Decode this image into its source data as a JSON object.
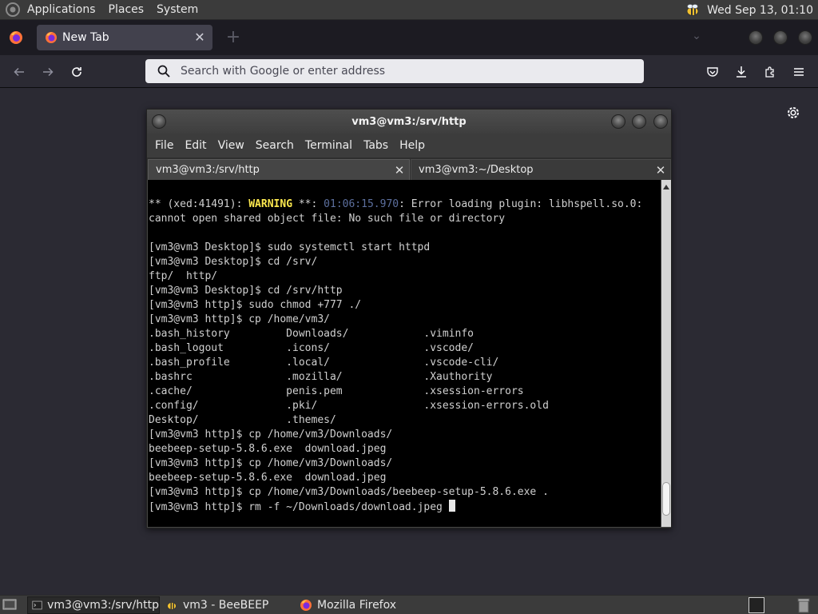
{
  "top_panel": {
    "menus": [
      "Applications",
      "Places",
      "System"
    ],
    "clock": "Wed Sep 13, 01:10",
    "tray_icon": "beebeep-bee-icon"
  },
  "browser": {
    "tab": {
      "label": "New Tab",
      "icon": "firefox-icon"
    },
    "urlbar": {
      "placeholder": "Search with Google or enter address",
      "value": ""
    },
    "colors": {
      "tab_bg": "#42414d",
      "toolbar_bg": "#2b2a33",
      "urlbar_bg": "#eaeaee"
    }
  },
  "terminal": {
    "title": "vm3@vm3:/srv/http",
    "menus": [
      "File",
      "Edit",
      "View",
      "Search",
      "Terminal",
      "Tabs",
      "Help"
    ],
    "tabs": [
      {
        "label": "vm3@vm3:/srv/http",
        "active": true
      },
      {
        "label": "vm3@vm3:~/Desktop",
        "active": false
      }
    ],
    "warning": {
      "prefix": "** (xed:41491): ",
      "label": "WARNING",
      "mid": " **: ",
      "time": "01:06:15.970",
      "message": ": Error loading plugin: libhspell.so.0:",
      "message2": "cannot open shared object file: No such file or directory"
    },
    "lines": [
      "[vm3@vm3 Desktop]$ sudo systemctl start httpd",
      "[vm3@vm3 Desktop]$ cd /srv/",
      "ftp/  http/",
      "[vm3@vm3 Desktop]$ cd /srv/http",
      "[vm3@vm3 http]$ sudo chmod +777 ./",
      "[vm3@vm3 http]$ cp /home/vm3/",
      ".bash_history         Downloads/            .viminfo",
      ".bash_logout          .icons/               .vscode/",
      ".bash_profile         .local/               .vscode-cli/",
      ".bashrc               .mozilla/             .Xauthority",
      ".cache/               penis.pem             .xsession-errors",
      ".config/              .pki/                 .xsession-errors.old",
      "Desktop/              .themes/",
      "[vm3@vm3 http]$ cp /home/vm3/Downloads/",
      "beebeep-setup-5.8.6.exe  download.jpeg",
      "[vm3@vm3 http]$ cp /home/vm3/Downloads/",
      "beebeep-setup-5.8.6.exe  download.jpeg",
      "[vm3@vm3 http]$ cp /home/vm3/Downloads/beebeep-setup-5.8.6.exe .",
      "[vm3@vm3 http]$ rm -f ~/Downloads/download.jpeg "
    ],
    "colors": {
      "bg": "#000000",
      "fg": "#d0d0d0",
      "warning": "#fce94f",
      "timestamp": "#5c6f9e"
    }
  },
  "taskbar": {
    "tasks": [
      {
        "label": "vm3@vm3:/srv/http",
        "icon": "terminal-icon",
        "active": true
      },
      {
        "label": "vm3 - BeeBEEP",
        "icon": "beebeep-bee-icon",
        "active": false
      },
      {
        "label": "Mozilla Firefox",
        "icon": "firefox-icon",
        "active": false
      }
    ]
  }
}
